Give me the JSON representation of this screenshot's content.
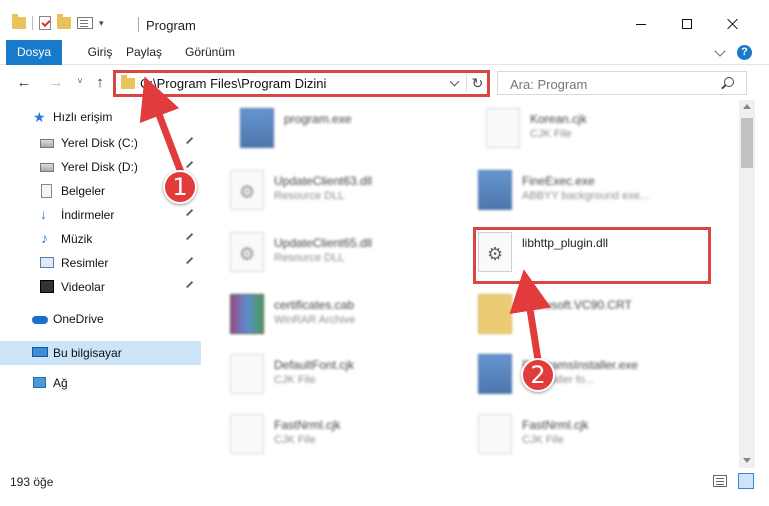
{
  "window": {
    "title": "Program",
    "controls": {
      "minimize": "minimize",
      "maximize": "maximize",
      "close": "close"
    }
  },
  "ribbon": {
    "tabs": [
      {
        "label": "Dosya"
      },
      {
        "label": "Giriş"
      },
      {
        "label": "Paylaş"
      },
      {
        "label": "Görünüm"
      }
    ],
    "help_label": "?"
  },
  "nav": {
    "back_glyph": "←",
    "forward_glyph": "→",
    "recent_glyph": "˅",
    "up_glyph": "↑",
    "refresh_glyph": "↻"
  },
  "address": {
    "path": "C:\\Program Files\\Program Dizini"
  },
  "search": {
    "placeholder": "Ara: Program"
  },
  "sidebar": {
    "items": [
      {
        "label": "Hızlı erişim"
      },
      {
        "label": "Yerel Disk (C:)"
      },
      {
        "label": "Yerel Disk (D:)"
      },
      {
        "label": "Belgeler"
      },
      {
        "label": "İndirmeler"
      },
      {
        "label": "Müzik"
      },
      {
        "label": "Resimler"
      },
      {
        "label": "Videolar"
      },
      {
        "label": "OneDrive"
      },
      {
        "label": "Bu bilgisayar"
      },
      {
        "label": "Ağ"
      }
    ]
  },
  "files": [
    {
      "name": "program.exe",
      "desc": ""
    },
    {
      "name": "Korean.cjk",
      "desc": "CJK File"
    },
    {
      "name": "UpdateClient63.dll",
      "desc": "Resource DLL"
    },
    {
      "name": "FineExec.exe",
      "desc": "ABBYY background exe..."
    },
    {
      "name": "UpdateClient65.dll",
      "desc": "Resource DLL"
    },
    {
      "name": "libhttp_plugin.dll",
      "desc": ""
    },
    {
      "name": "certificates.cab",
      "desc": "WinRAR Archive"
    },
    {
      "name": "Microsoft.VC90.CRT",
      "desc": ""
    },
    {
      "name": "DefaultFont.cjk",
      "desc": "CJK File"
    },
    {
      "name": "ProgramsInstaller.exe",
      "desc": "... Installer fo..."
    },
    {
      "name": "FastNrml.cjk",
      "desc": "CJK File"
    },
    {
      "name": "FastNrml.cjk",
      "desc": "CJK File"
    }
  ],
  "annotations": {
    "step1": "1",
    "step2": "2"
  },
  "status": {
    "count": "193 öğe"
  },
  "colors": {
    "accent": "#1979ca",
    "highlight": "#d84545",
    "selected": "#cce4f7"
  }
}
